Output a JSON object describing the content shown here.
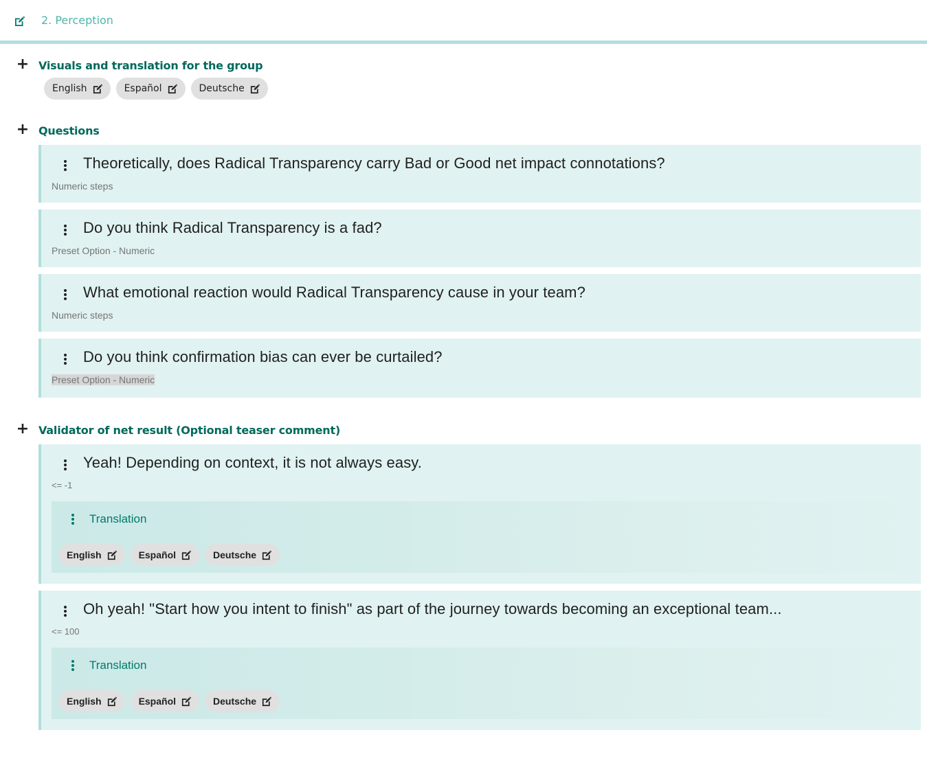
{
  "header": {
    "title": "2. Perception",
    "edit_icon": "edit-icon"
  },
  "colors": {
    "accent": "#4db6ac",
    "accent_dark": "#00695c",
    "card_bg": "#e0f2f1",
    "card_border": "#b2dfdb",
    "chip_bg": "#e0e0e0"
  },
  "visuals": {
    "title": "Visuals and translation for the group",
    "languages": [
      {
        "label": "English",
        "icon": "edit-icon"
      },
      {
        "label": "Español",
        "icon": "edit-icon"
      },
      {
        "label": "Deutsche",
        "icon": "edit-icon"
      }
    ]
  },
  "questions": {
    "title": "Questions",
    "items": [
      {
        "title": "Theoretically, does Radical Transparency carry Bad or Good net impact connotations?",
        "type": "Numeric steps"
      },
      {
        "title": "Do you think Radical Transparency is a fad?",
        "type": "Preset Option - Numeric"
      },
      {
        "title": "What emotional reaction would Radical Transparency cause in your team?",
        "type": "Numeric steps"
      },
      {
        "title": "Do you think confirmation bias can ever be curtailed?",
        "type": "Preset Option - Numeric"
      }
    ]
  },
  "validator": {
    "title": "Validator of net result (Optional teaser comment)",
    "items": [
      {
        "title": "Yeah! Depending on context, it is not always easy.",
        "condition": "<= -1",
        "translation": {
          "title": "Translation",
          "languages": [
            {
              "label": "English",
              "icon": "edit-icon"
            },
            {
              "label": "Español",
              "icon": "edit-icon"
            },
            {
              "label": "Deutsche",
              "icon": "edit-icon"
            }
          ]
        }
      },
      {
        "title": "Oh yeah! \"Start how you intent to finish\" as part of the journey towards becoming an exceptional team...",
        "condition": "<= 100",
        "translation": {
          "title": "Translation",
          "languages": [
            {
              "label": "English",
              "icon": "edit-icon"
            },
            {
              "label": "Español",
              "icon": "edit-icon"
            },
            {
              "label": "Deutsche",
              "icon": "edit-icon"
            }
          ]
        }
      }
    ]
  }
}
